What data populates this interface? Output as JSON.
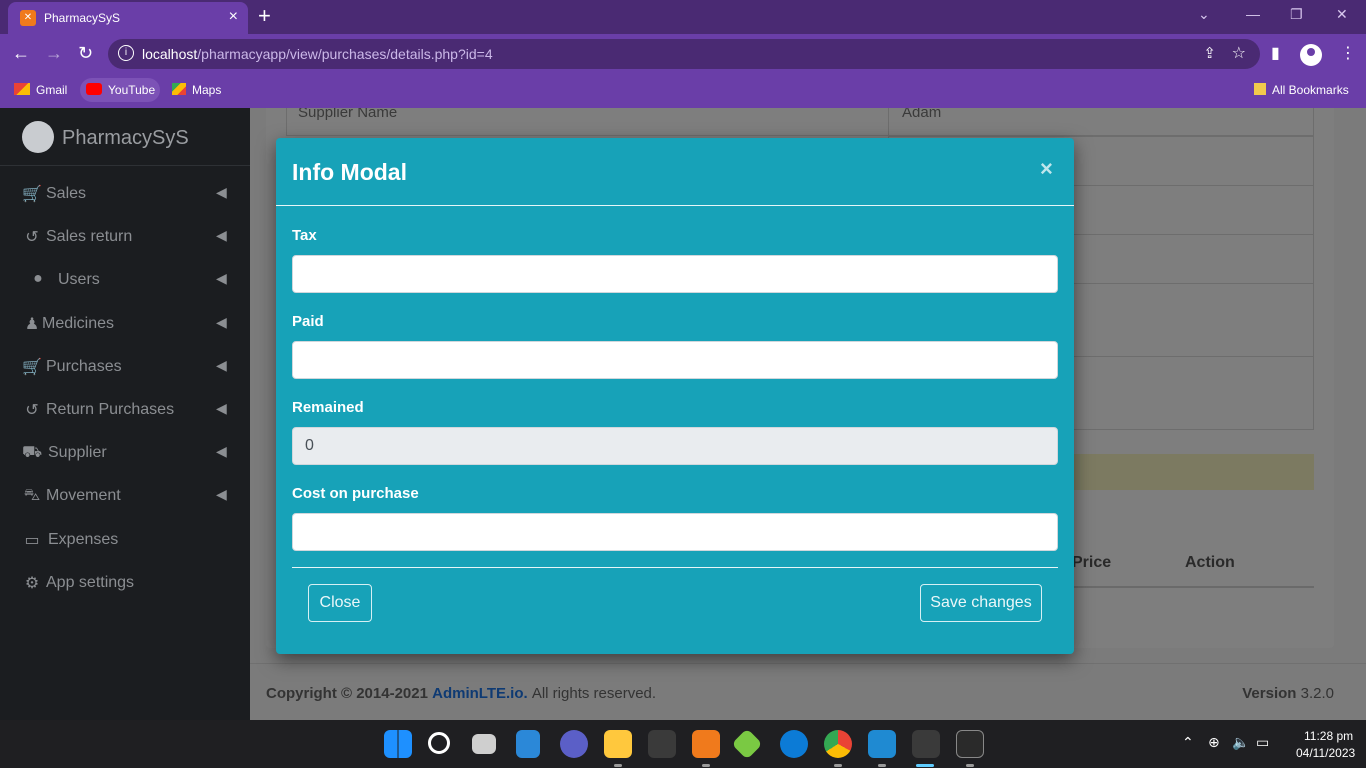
{
  "browser": {
    "tab_title": "PharmacySyS",
    "tab_favicon": "xampp-icon",
    "url_host": "localhost",
    "url_path": "/pharmacyapp/view/purchases/details.php?id=4",
    "bookmarks": [
      {
        "label": "Gmail",
        "icon": "gmail-icon",
        "color": "#ea4335"
      },
      {
        "label": "YouTube",
        "icon": "youtube-icon",
        "color": "#ff0000"
      },
      {
        "label": "Maps",
        "icon": "maps-icon",
        "color": "#34a853"
      }
    ],
    "all_bookmarks": "All Bookmarks"
  },
  "sidebar": {
    "brand": "PharmacySyS",
    "items": [
      {
        "label": "Sales",
        "icon": "cart-icon"
      },
      {
        "label": "Sales return",
        "icon": "undo-icon"
      },
      {
        "label": "Users",
        "icon": "user-icon"
      },
      {
        "label": "Medicines",
        "icon": "user-md-icon"
      },
      {
        "label": "Purchases",
        "icon": "cart-icon"
      },
      {
        "label": "Return Purchases",
        "icon": "undo-icon"
      },
      {
        "label": "Supplier",
        "icon": "truck-icon"
      },
      {
        "label": "Movement",
        "icon": "car-icon"
      },
      {
        "label": "Expenses",
        "icon": "money-icon"
      },
      {
        "label": "App settings",
        "icon": "gear-icon"
      }
    ]
  },
  "details": {
    "supplier_label": "Supplier Name",
    "supplier_value": "Adam",
    "table_headers": {
      "price": "Price",
      "action": "Action"
    }
  },
  "modal": {
    "title": "Info Modal",
    "fields": [
      {
        "label": "Tax",
        "value": "",
        "disabled": false
      },
      {
        "label": "Paid",
        "value": "",
        "disabled": false
      },
      {
        "label": "Remained",
        "value": "0",
        "disabled": true
      },
      {
        "label": "Cost on purchase",
        "value": "",
        "disabled": false
      }
    ],
    "close_label": "Close",
    "save_label": "Save changes"
  },
  "footer": {
    "copyright": "Copyright © 2014-2021",
    "brand_link": "AdminLTE.io.",
    "rights": "All rights reserved.",
    "version_label": "Version",
    "version_value": "3.2.0"
  },
  "taskbar": {
    "time": "11:28 pm",
    "date": "04/11/2023"
  },
  "colors": {
    "modal_bg": "#17a2b8",
    "sidebar_bg": "#1b1d20",
    "browser_accent": "#6a3ea8"
  }
}
